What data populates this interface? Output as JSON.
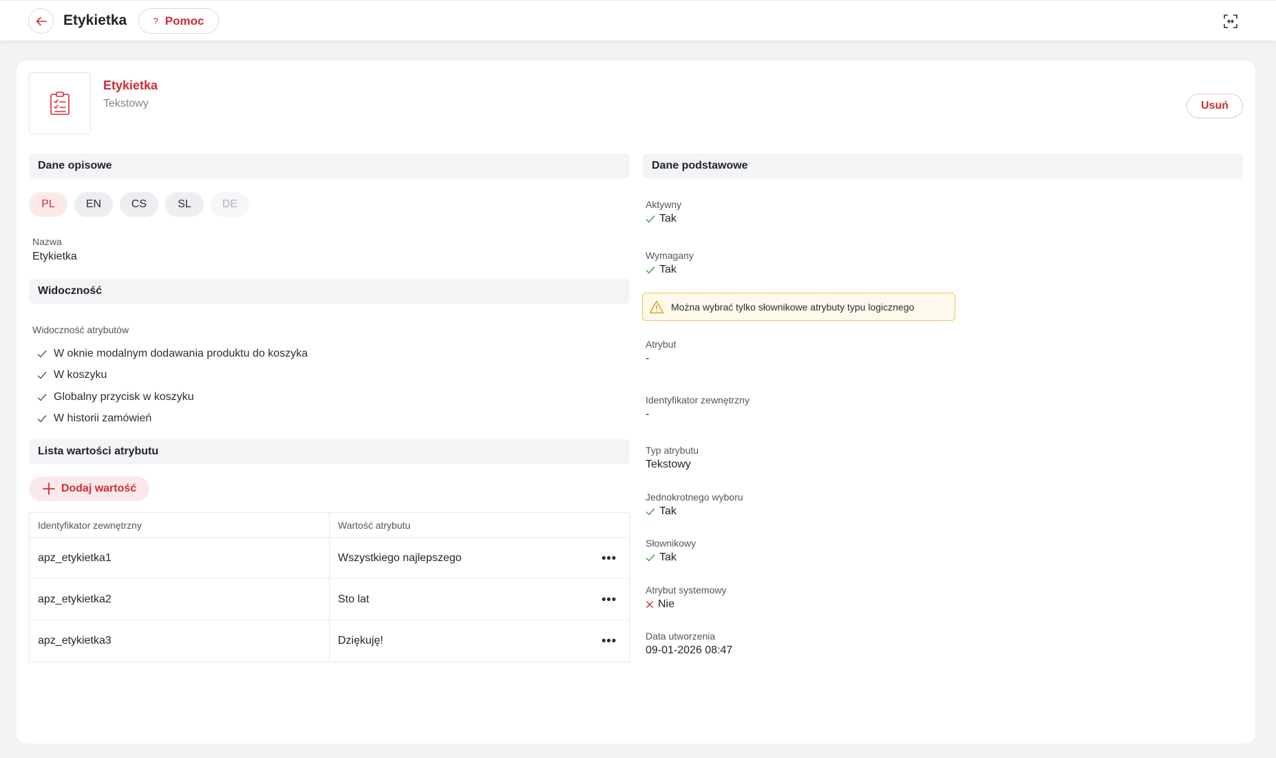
{
  "topbar": {
    "title": "Etykietka",
    "help_label": "Pomoc",
    "help_glyph": "?"
  },
  "item": {
    "name": "Etykietka",
    "type": "Tekstowy",
    "delete_label": "Usuń"
  },
  "descriptive": {
    "heading": "Dane opisowe",
    "languages": [
      {
        "code": "PL",
        "state": "active"
      },
      {
        "code": "EN",
        "state": "normal"
      },
      {
        "code": "CS",
        "state": "normal"
      },
      {
        "code": "SL",
        "state": "normal"
      },
      {
        "code": "DE",
        "state": "disabled"
      }
    ],
    "name_label": "Nazwa",
    "name_value": "Etykietka"
  },
  "visibility": {
    "heading": "Widoczność",
    "label": "Widoczność atrybutów",
    "items": [
      "W oknie modalnym dodawania produktu do koszyka",
      "W koszyku",
      "Globalny przycisk w koszyku",
      "W historii zamówień"
    ]
  },
  "values_list": {
    "heading": "Lista wartości atrybutu",
    "add_label": "Dodaj wartość",
    "columns": [
      "Identyfikator zewnętrzny",
      "Wartość atrybutu"
    ],
    "rows": [
      [
        "apz_etykietka1",
        "Wszystkiego najlepszego"
      ],
      [
        "apz_etykietka2",
        "Sto lat"
      ],
      [
        "apz_etykietka3",
        "Dziękuję!"
      ]
    ],
    "row_menu_glyph": "•••"
  },
  "basic": {
    "heading": "Dane podstawowe",
    "active_label": "Aktywny",
    "active_value": "Tak",
    "required_label": "Wymagany",
    "required_value": "Tak",
    "warning_text": "Można wybrać tylko słownikowe atrybuty typu logicznego",
    "attribute_label": "Atrybut",
    "attribute_value": "-",
    "external_id_label": "Identyfikator zewnętrzny",
    "external_id_value": "-",
    "type_label": "Typ atrybutu",
    "type_value": "Tekstowy",
    "single_choice_label": "Jednokrotnego wyboru",
    "single_choice_value": "Tak",
    "dictionary_label": "Słownikowy",
    "dictionary_value": "Tak",
    "system_label": "Atrybut systemowy",
    "system_value": "Nie",
    "created_label": "Data utworzenia",
    "created_value": "09-01-2026 08:47"
  },
  "colors": {
    "accent": "#d02b34",
    "check": "#3a9a4a",
    "cross": "#d02b34",
    "warning_border": "#f2c063"
  }
}
